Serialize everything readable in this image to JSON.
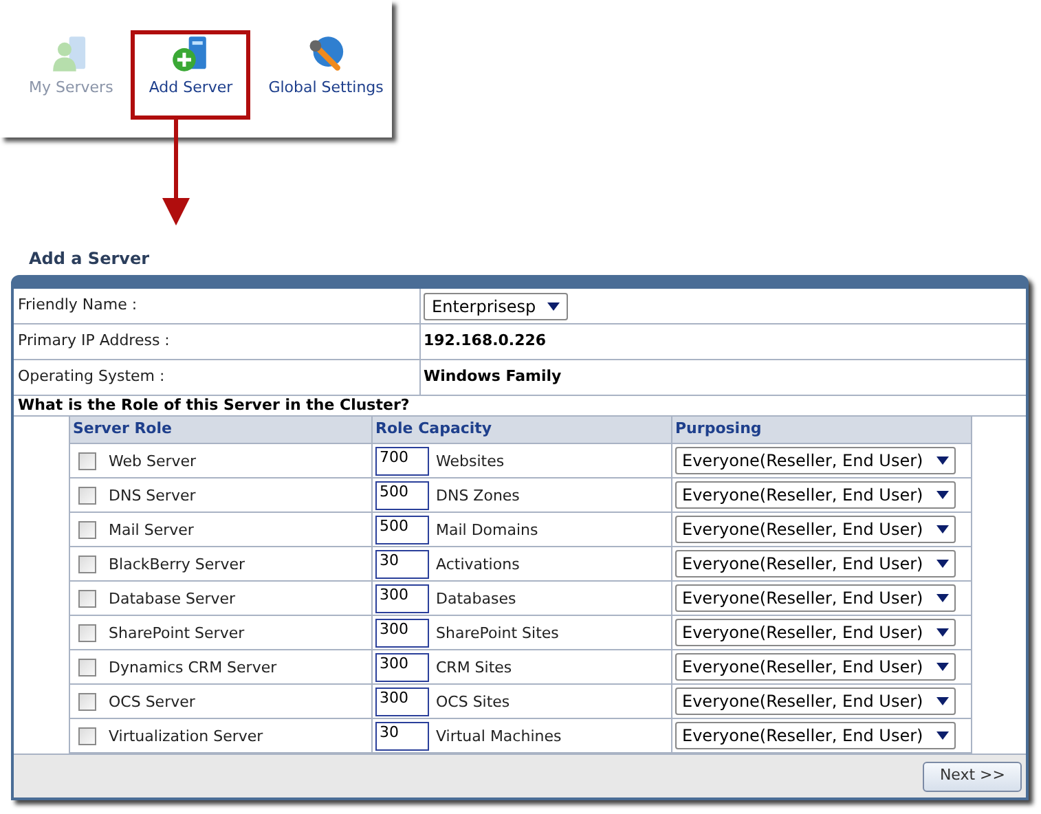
{
  "toolbar": [
    {
      "label": "My Servers",
      "kind": "servers",
      "disabled": true,
      "selected": false
    },
    {
      "label": "Add Server",
      "kind": "add",
      "disabled": false,
      "selected": true
    },
    {
      "label": "Global Settings",
      "kind": "settings",
      "disabled": false,
      "selected": false
    }
  ],
  "panel": {
    "title": "Add a Server",
    "fields": [
      {
        "label": "Friendly Name :",
        "kind": "select",
        "value": "Enterprisesp"
      },
      {
        "label": "Primary IP Address :",
        "kind": "text",
        "value": "192.168.0.226"
      },
      {
        "label": "Operating System :",
        "kind": "text",
        "value": "Windows Family"
      }
    ],
    "question": "What is the Role of this Server in the Cluster?",
    "columns": [
      "Server Role",
      "Role Capacity",
      "Purposing"
    ],
    "rows": [
      {
        "role": "Web Server",
        "checked": false,
        "capacity": "700",
        "unit": "Websites",
        "purposing": "Everyone(Reseller, End User)"
      },
      {
        "role": "DNS Server",
        "checked": false,
        "capacity": "500",
        "unit": "DNS Zones",
        "purposing": "Everyone(Reseller, End User)"
      },
      {
        "role": "Mail Server",
        "checked": false,
        "capacity": "500",
        "unit": "Mail Domains",
        "purposing": "Everyone(Reseller, End User)"
      },
      {
        "role": "BlackBerry Server",
        "checked": false,
        "capacity": "30",
        "unit": "Activations",
        "purposing": "Everyone(Reseller, End User)"
      },
      {
        "role": "Database Server",
        "checked": false,
        "capacity": "300",
        "unit": "Databases",
        "purposing": "Everyone(Reseller, End User)"
      },
      {
        "role": "SharePoint Server",
        "checked": false,
        "capacity": "300",
        "unit": "SharePoint Sites",
        "purposing": "Everyone(Reseller, End User)"
      },
      {
        "role": "Dynamics CRM Server",
        "checked": false,
        "capacity": "300",
        "unit": "CRM Sites",
        "purposing": "Everyone(Reseller, End User)"
      },
      {
        "role": "OCS Server",
        "checked": false,
        "capacity": "300",
        "unit": "OCS Sites",
        "purposing": "Everyone(Reseller, End User)"
      },
      {
        "role": "Virtualization Server",
        "checked": false,
        "capacity": "30",
        "unit": "Virtual Machines",
        "purposing": "Everyone(Reseller, End User)"
      }
    ],
    "next_button": "Next >>"
  }
}
